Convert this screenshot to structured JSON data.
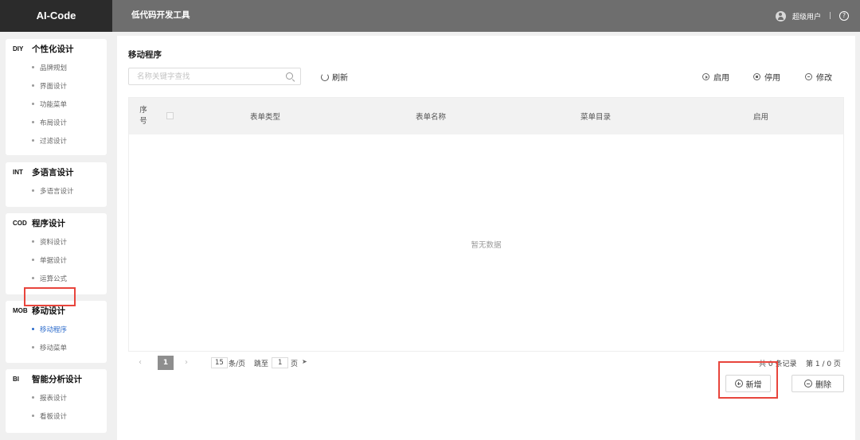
{
  "app": {
    "logo": "AI-Code",
    "title": "低代码开发工具",
    "user": "超级用户",
    "separator": "|",
    "help": "?"
  },
  "colors": {
    "topbar": "#6e6e6e",
    "logo_bg": "#2b2b2b",
    "active": "#2a6acb",
    "highlight": "#e8453c"
  },
  "sidebar": {
    "groups": [
      {
        "code": "DIY",
        "title": "个性化设计",
        "items": [
          "品牌规划",
          "界面设计",
          "功能菜单",
          "布局设计",
          "过滤设计"
        ]
      },
      {
        "code": "INT",
        "title": "多语言设计",
        "items": [
          "多语言设计"
        ]
      },
      {
        "code": "COD",
        "title": "程序设计",
        "items": [
          "资料设计",
          "单据设计",
          "运算公式"
        ]
      },
      {
        "code": "MOB",
        "title": "移动设计",
        "items": [
          "移动程序",
          "移动菜单"
        ]
      },
      {
        "code": "BI",
        "title": "智能分析设计",
        "items": [
          "报表设计",
          "看板设计"
        ]
      }
    ],
    "active_item": "移动程序"
  },
  "main": {
    "page_title": "移动程序",
    "search": {
      "placeholder": "名称关键字查找",
      "value": ""
    },
    "refresh_label": "刷新",
    "actions": {
      "enable": "启用",
      "disable": "停用",
      "edit": "修改"
    },
    "table": {
      "columns": {
        "seq": "序号",
        "form_type": "表单类型",
        "form_name": "表单名称",
        "menu_dir": "菜单目录",
        "enabled": "启用"
      },
      "rows": [],
      "empty_text": "暂无数据"
    },
    "pager": {
      "prev": "‹",
      "next": "›",
      "current_page": "1",
      "page_size": "15",
      "page_size_unit": "条/页",
      "jump_label": "跳至",
      "jump_value": "1",
      "jump_unit": "页",
      "go_icon": "send-icon",
      "total_text": "共 0 条记录",
      "page_text": "第 1 / 0 页"
    },
    "buttons": {
      "add": "新增",
      "delete": "删除"
    }
  }
}
